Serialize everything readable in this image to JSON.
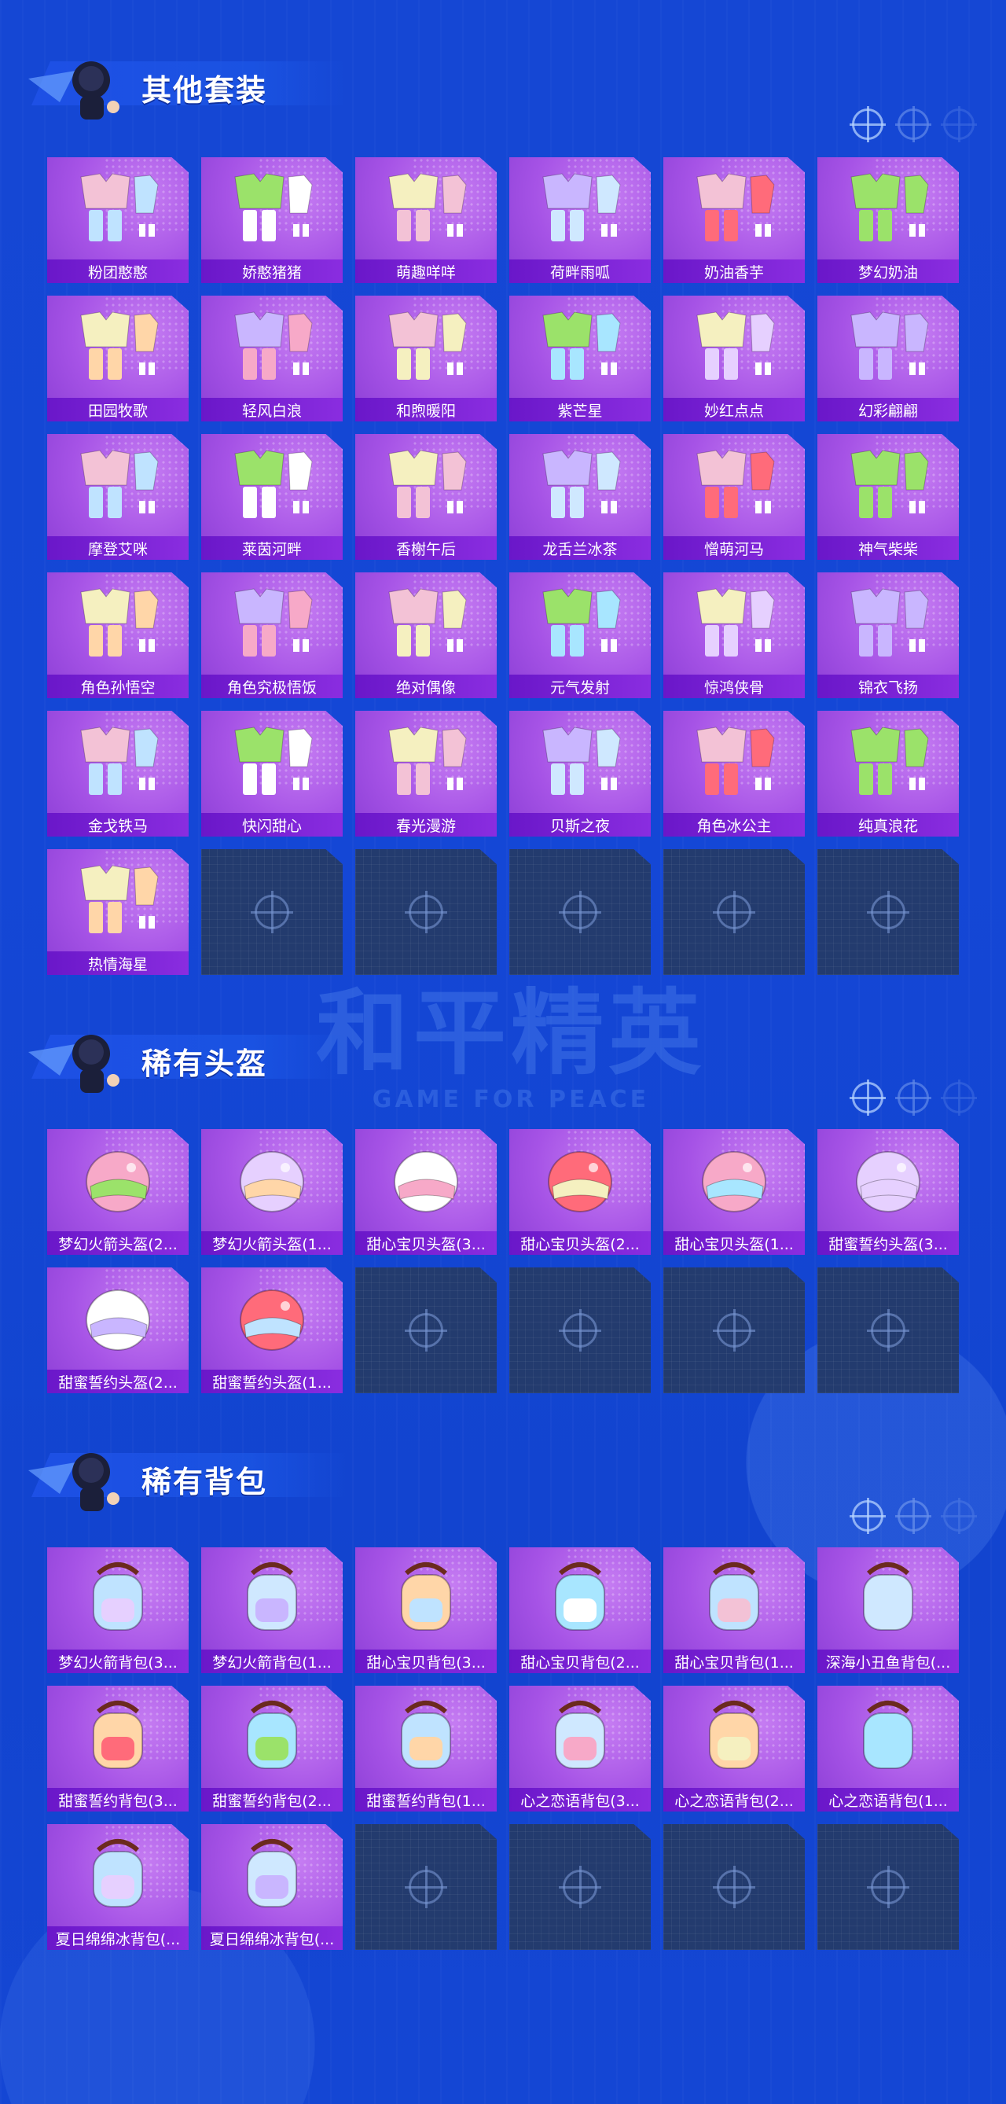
{
  "watermark": {
    "main": "和平精英",
    "sub": "GAME FOR PEACE"
  },
  "sections": [
    {
      "title": "其他套装",
      "items": [
        "粉团憨憨",
        "娇憨猪猪",
        "萌趣咩咩",
        "荷畔雨呱",
        "奶油香芋",
        "梦幻奶油",
        "田园牧歌",
        "轻风白浪",
        "和煦暖阳",
        "紫芒星",
        "妙红点点",
        "幻彩翩翩",
        "摩登艾咪",
        "莱茵河畔",
        "香榭午后",
        "龙舌兰冰茶",
        "憎萌河马",
        "神气柴柴",
        "角色孙悟空",
        "角色究极悟饭",
        "绝对偶像",
        "元气发射",
        "惊鸿侠骨",
        "锦衣飞扬",
        "金戈铁马",
        "快闪甜心",
        "春光漫游",
        "贝斯之夜",
        "角色冰公主",
        "纯真浪花",
        "热情海星"
      ],
      "empty_slots": 5
    },
    {
      "title": "稀有头盔",
      "items": [
        "梦幻火箭头盔(2...",
        "梦幻火箭头盔(1...",
        "甜心宝贝头盔(3...",
        "甜心宝贝头盔(2...",
        "甜心宝贝头盔(1...",
        "甜蜜誓约头盔(3...",
        "甜蜜誓约头盔(2...",
        "甜蜜誓约头盔(1..."
      ],
      "empty_slots": 4
    },
    {
      "title": "稀有背包",
      "items": [
        "梦幻火箭背包(3...",
        "梦幻火箭背包(1...",
        "甜心宝贝背包(3...",
        "甜心宝贝背包(2...",
        "甜心宝贝背包(1...",
        "深海小丑鱼背包(...",
        "甜蜜誓约背包(3...",
        "甜蜜誓约背包(2...",
        "甜蜜誓约背包(1...",
        "心之恋语背包(3...",
        "心之恋语背包(2...",
        "心之恋语背包(1...",
        "夏日绵绵冰背包(...",
        "夏日绵绵冰背包(..."
      ],
      "empty_slots": 4
    }
  ]
}
